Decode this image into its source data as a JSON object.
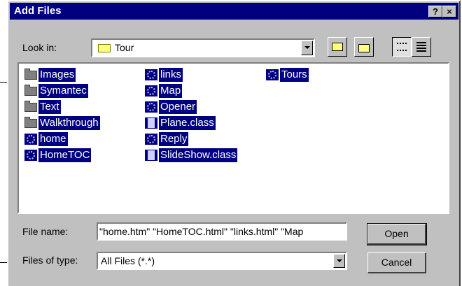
{
  "window": {
    "title": "Add Files",
    "help_label": "?",
    "close_label": "×"
  },
  "lookin": {
    "label": "Look in:",
    "value": "Tour"
  },
  "toolbar": {
    "up_folder_icon": "up-folder-icon",
    "new_folder_icon": "new-folder-icon",
    "list_icon": "list-view-icon",
    "details_icon": "details-view-icon"
  },
  "files": {
    "col1": [
      {
        "name": "Images",
        "type": "folder"
      },
      {
        "name": "Symantec",
        "type": "folder"
      },
      {
        "name": "Text",
        "type": "folder"
      },
      {
        "name": "Walkthrough",
        "type": "folder"
      },
      {
        "name": "home",
        "type": "html"
      },
      {
        "name": "HomeTOC",
        "type": "html"
      }
    ],
    "col2": [
      {
        "name": "links",
        "type": "html"
      },
      {
        "name": "Map",
        "type": "html"
      },
      {
        "name": "Opener",
        "type": "html"
      },
      {
        "name": "Plane.class",
        "type": "class"
      },
      {
        "name": "Reply",
        "type": "html"
      },
      {
        "name": "SlideShow.class",
        "type": "class"
      }
    ],
    "col3": [
      {
        "name": "Tours",
        "type": "html"
      }
    ]
  },
  "filename": {
    "label": "File name:",
    "value": "\"home.htm\" \"HomeTOC.html\" \"links.html\" \"Map"
  },
  "filetype": {
    "label": "Files of type:",
    "value": "All Files (*.*)"
  },
  "buttons": {
    "open": "Open",
    "cancel": "Cancel"
  }
}
